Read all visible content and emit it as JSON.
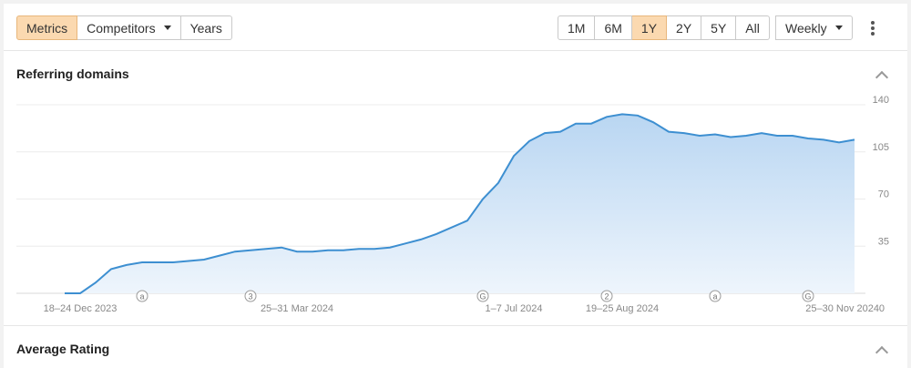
{
  "toolbar": {
    "view_tabs": [
      {
        "label": "Metrics",
        "active": true
      },
      {
        "label": "Competitors",
        "active": false,
        "dropdown": true
      },
      {
        "label": "Years",
        "active": false
      }
    ],
    "ranges": [
      {
        "label": "1M",
        "active": false
      },
      {
        "label": "6M",
        "active": false
      },
      {
        "label": "1Y",
        "active": true
      },
      {
        "label": "2Y",
        "active": false
      },
      {
        "label": "5Y",
        "active": false
      },
      {
        "label": "All",
        "active": false
      }
    ],
    "interval": "Weekly",
    "more_icon": "kebab-icon"
  },
  "sections": {
    "referring_domains": {
      "title": "Referring domains",
      "collapse_icon": "chevron-up-icon"
    },
    "average_rating": {
      "title": "Average Rating",
      "collapse_icon": "chevron-up-icon"
    }
  },
  "colors": {
    "line": "#3d8fd1",
    "fill_top": "#b9d6f2",
    "fill_bottom": "#eef5fc",
    "active_bg": "#fbd9b0"
  },
  "chart_data": {
    "type": "area",
    "title": "Referring domains",
    "ylim": [
      0,
      140
    ],
    "y_ticks": [
      0,
      35,
      70,
      105,
      140
    ],
    "x_tick_labels": [
      "18–24 Dec 2023",
      "25–31 Mar 2024",
      "1–7 Jul 2024",
      "19–25 Aug 2024",
      "25–30 Nov 2024"
    ],
    "x_tick_weeks": [
      1,
      15,
      29,
      36,
      50
    ],
    "annotations": [
      {
        "week": 5,
        "label": "a"
      },
      {
        "week": 12,
        "label": "3"
      },
      {
        "week": 27,
        "label": "G"
      },
      {
        "week": 35,
        "label": "2"
      },
      {
        "week": 42,
        "label": "a"
      },
      {
        "week": 48,
        "label": "G"
      }
    ],
    "series": [
      {
        "values": [
          0,
          0,
          8,
          18,
          21,
          23,
          23,
          23,
          24,
          25,
          28,
          31,
          32,
          33,
          34,
          31,
          31,
          32,
          32,
          33,
          33,
          34,
          37,
          40,
          44,
          49,
          54,
          70,
          82,
          102,
          113,
          119,
          120,
          126,
          126,
          131,
          133,
          132,
          127,
          120,
          119,
          117,
          118,
          116,
          117,
          119,
          117,
          117,
          115,
          114,
          112,
          114
        ]
      }
    ]
  }
}
